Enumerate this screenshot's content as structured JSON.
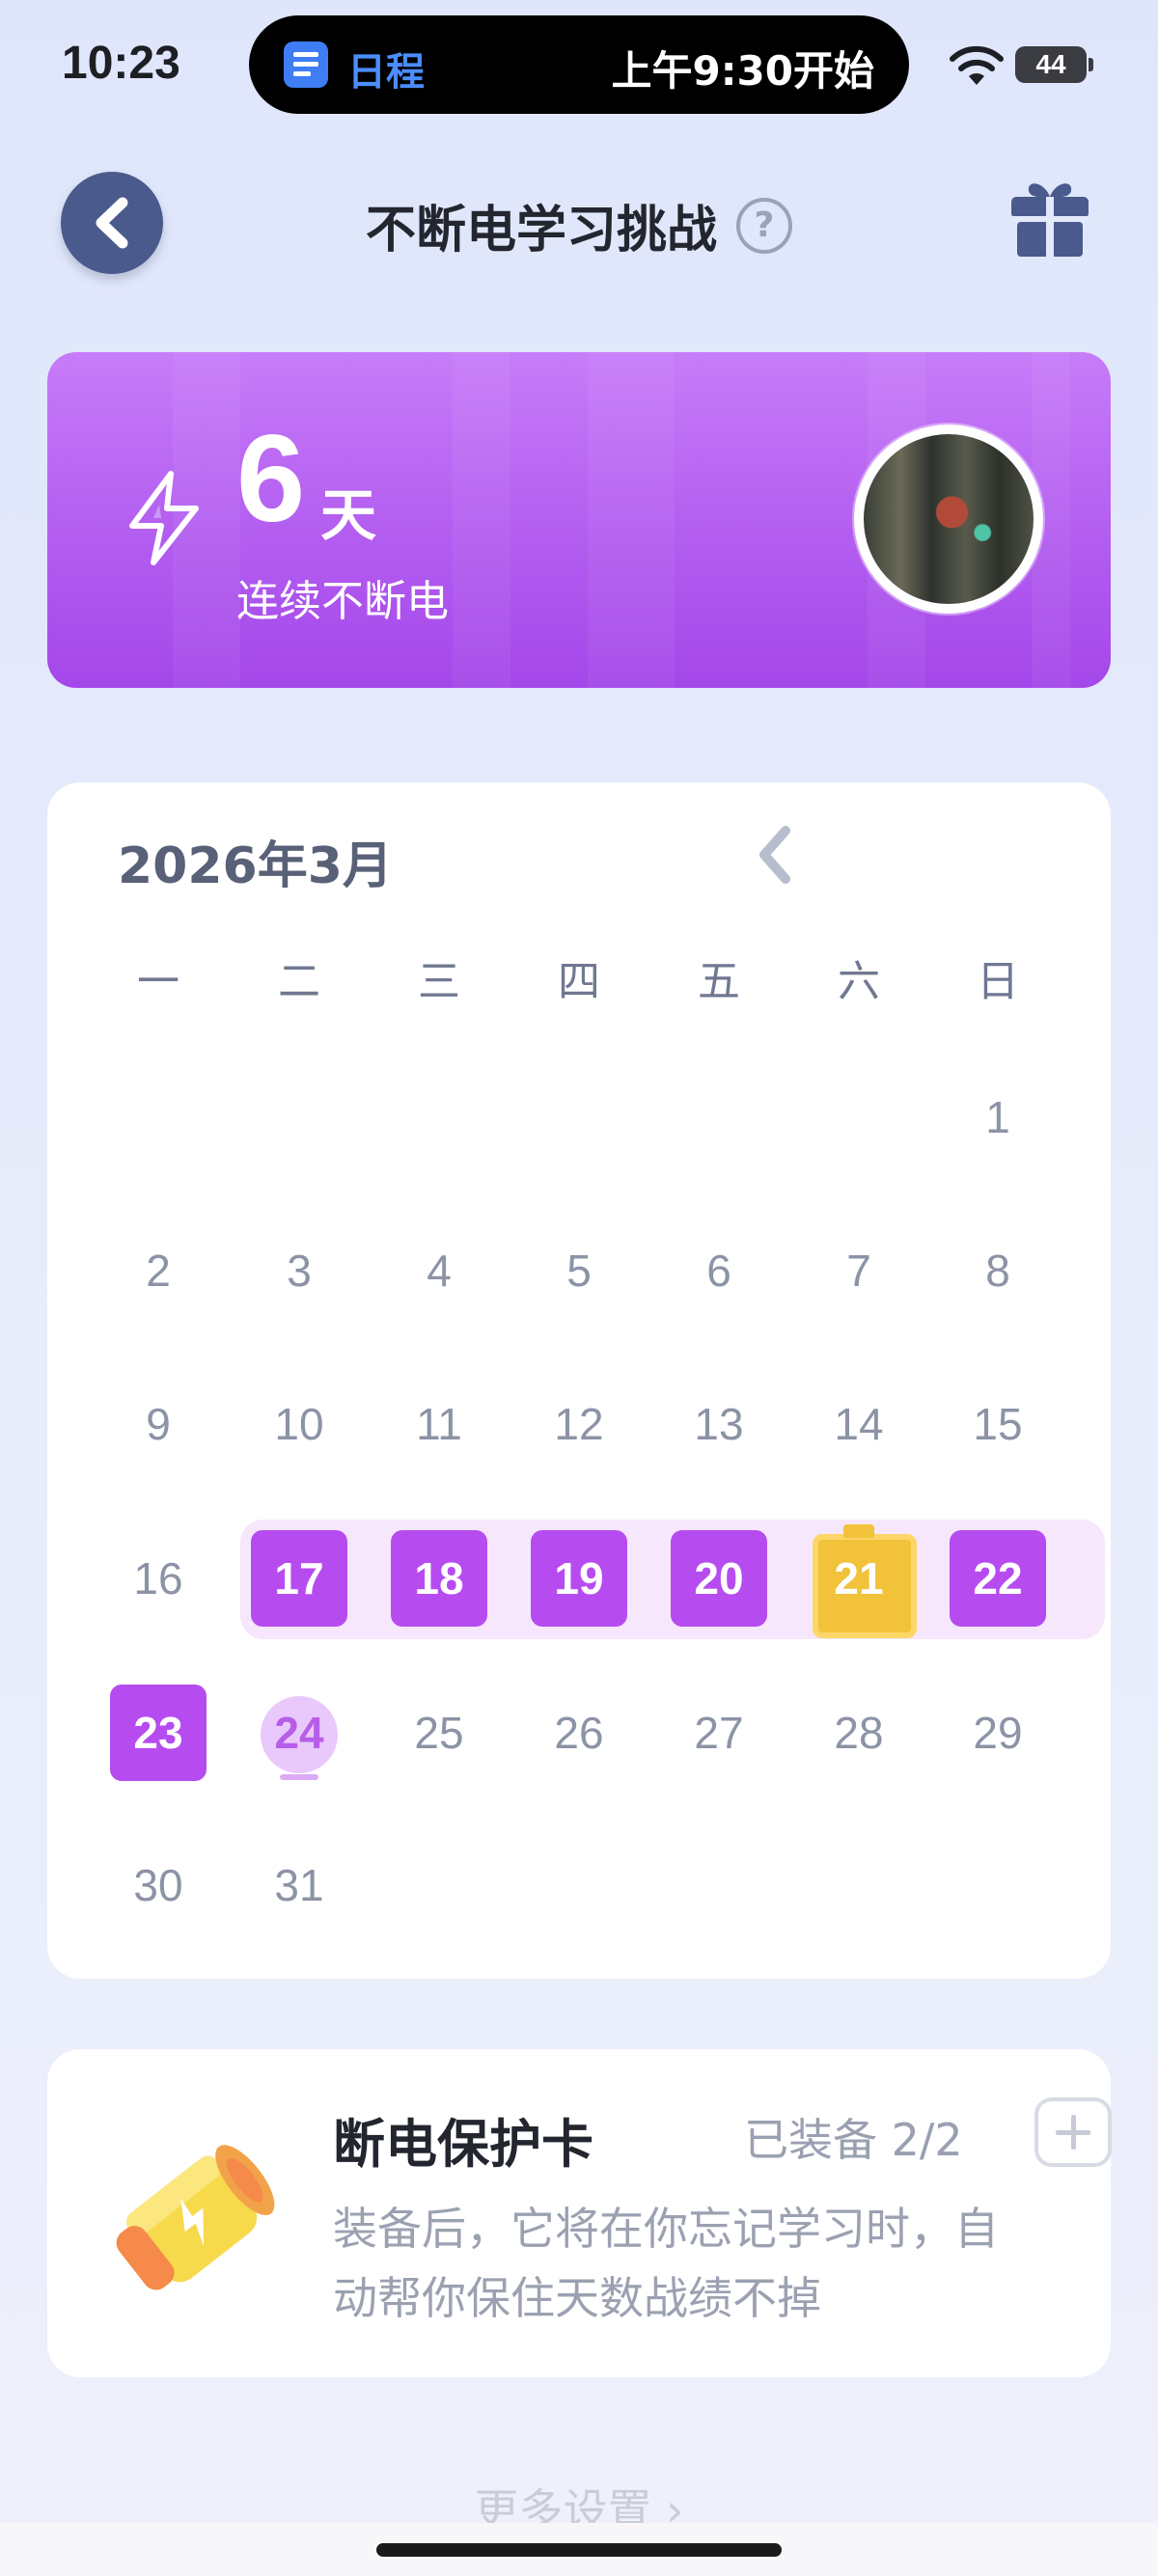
{
  "status_bar": {
    "time": "10:23",
    "island_app": "日程",
    "island_event": "上午9:30开始",
    "battery": "44"
  },
  "header": {
    "title": "不断电学习挑战",
    "help": "?"
  },
  "streak": {
    "count": "6",
    "unit": "天",
    "label": "连续不断电"
  },
  "calendar": {
    "month": "2026年3月",
    "weekdays": [
      "一",
      "二",
      "三",
      "四",
      "五",
      "六",
      "日"
    ],
    "first_weekday_index": 6,
    "days_in_month": 31,
    "done_days": [
      17,
      18,
      19,
      20,
      22,
      23
    ],
    "protected_days": [
      21
    ],
    "today": 24
  },
  "protection_card": {
    "title": "断电保护卡",
    "status": "已装备 2/2",
    "description_line1": "装备后，它将在你忘记学习时，自",
    "description_line2": "动帮你保住天数战绩不掉"
  },
  "footer": {
    "more_settings": "更多设置 ›"
  },
  "colors": {
    "accent": "#b64cf0",
    "protected": "#f1c23a",
    "today": "#e9c8fb"
  }
}
